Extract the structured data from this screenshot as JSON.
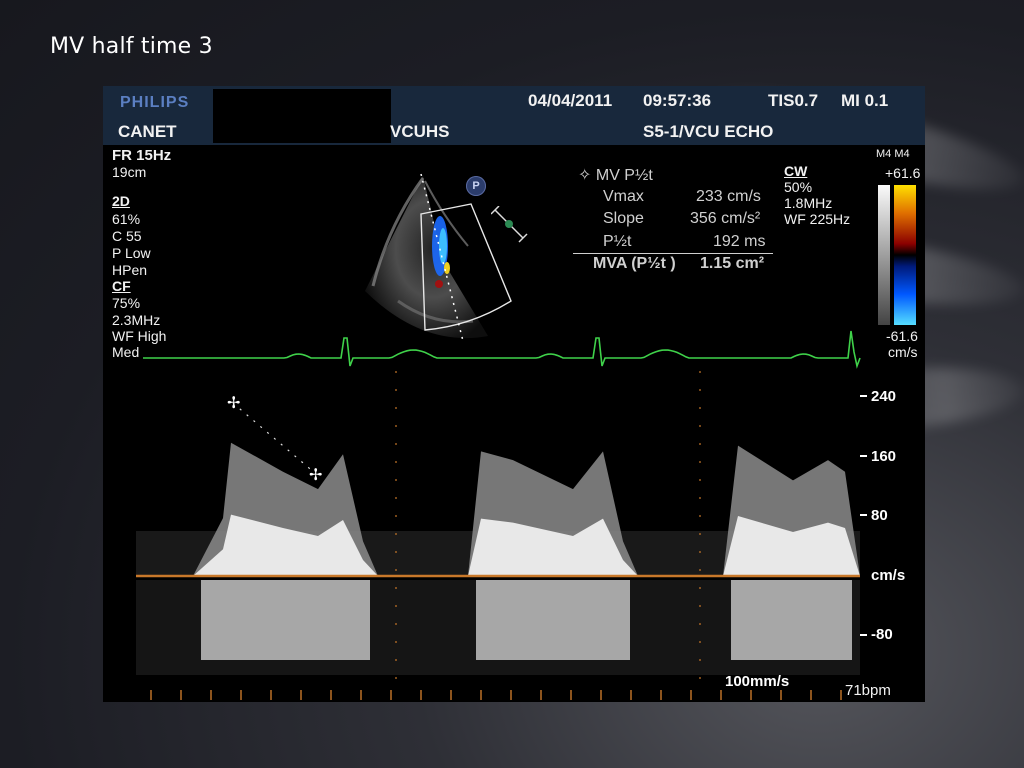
{
  "slide": {
    "title": "MV half time 3"
  },
  "header": {
    "brand": "PHILIPS",
    "patient": "CANET",
    "institution": "VCUHS",
    "date": "04/04/2011",
    "time": "09:57:36",
    "tis": "TIS0.7",
    "mi": "MI 0.1",
    "probe": "S5-1/VCU ECHO"
  },
  "left_panel": {
    "frame_rate": "FR 15Hz",
    "depth": "19cm",
    "mode_2d": "2D",
    "gain_2d": " 61%",
    "compress": "C 55",
    "power": "P Low",
    "harmonic": "HPen",
    "mode_cf": "CF",
    "gain_cf": " 75%",
    "freq_cf": "2.3MHz",
    "filter_cf": "WF High",
    "persist": "Med"
  },
  "measurements": {
    "header": "MV P½t",
    "vmax_label": "Vmax",
    "vmax_value": "233 cm/s",
    "slope_label": "Slope",
    "slope_value": "356 cm/s²",
    "pht_label": "P½t",
    "pht_value": "192 ms",
    "mva_label": "MVA (P½t )",
    "mva_value": "1.15 cm²"
  },
  "cw_panel": {
    "mode": "CW",
    "gain": " 50%",
    "freq": "1.8MHz",
    "filter": "WF 225Hz"
  },
  "color_scale": {
    "map": "M4 M4",
    "top": "+61.6",
    "bottom": "-61.6",
    "unit": "cm/s"
  },
  "doppler_axis": {
    "ticks": [
      "240",
      "160",
      "80",
      "cm/s",
      "-80"
    ],
    "sweep_speed": "100mm/s",
    "heart_rate": "71bpm"
  },
  "colors": {
    "header_bg": "#18283c",
    "ecg": "#3fd24a",
    "baseline": "#c8782a",
    "brand": "#5b7fc2"
  },
  "icons": {
    "probe_marker": "P",
    "transducer": "tx-icon"
  }
}
